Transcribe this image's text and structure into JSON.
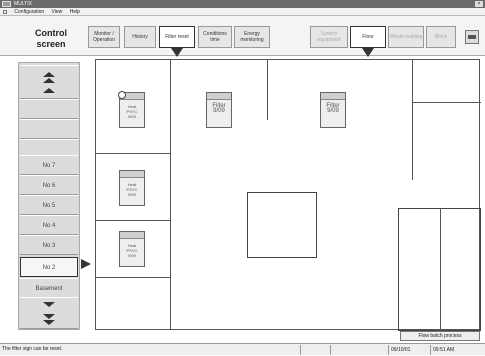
{
  "window": {
    "title": "MULTIX",
    "close_glyph": "×"
  },
  "menu": {
    "items": [
      "Configuration",
      "View",
      "Help"
    ]
  },
  "header": {
    "title": "Control screen",
    "tabs_left": [
      {
        "label": "Monitor / Operation",
        "active": false
      },
      {
        "label": "History",
        "active": false
      },
      {
        "label": "Filter reset",
        "active": true
      },
      {
        "label": "Conditions time",
        "active": false
      },
      {
        "label": "Energy monitoring",
        "active": false
      }
    ],
    "tabs_right": [
      {
        "label": "System equipment",
        "active": false,
        "disabled": true
      },
      {
        "label": "Floor",
        "active": true,
        "disabled": false
      },
      {
        "label": "Whole building",
        "active": false,
        "disabled": true
      },
      {
        "label": "Block",
        "active": false,
        "disabled": true
      }
    ]
  },
  "sidebar": {
    "floors": [
      "No 7",
      "No 6",
      "No 5",
      "No 4",
      "No 3",
      "No 2",
      "Basement"
    ],
    "selected": "No 2"
  },
  "units": [
    {
      "label": "Heat\nPSYC\n9/09",
      "clock": true
    },
    {
      "label": "Filter\n9/09",
      "clock": false
    },
    {
      "label": "Filter\n9/09",
      "clock": false
    },
    {
      "label": "Heat\nPSYC\n9/09",
      "clock": false
    },
    {
      "label": "Heat\nPSYC\n9/09",
      "clock": false
    }
  ],
  "actions": {
    "batch_label": "Flow batch process"
  },
  "status": {
    "message": "The filter sign can be reset.",
    "date": "09/10/01",
    "time": "09:51 AM"
  }
}
